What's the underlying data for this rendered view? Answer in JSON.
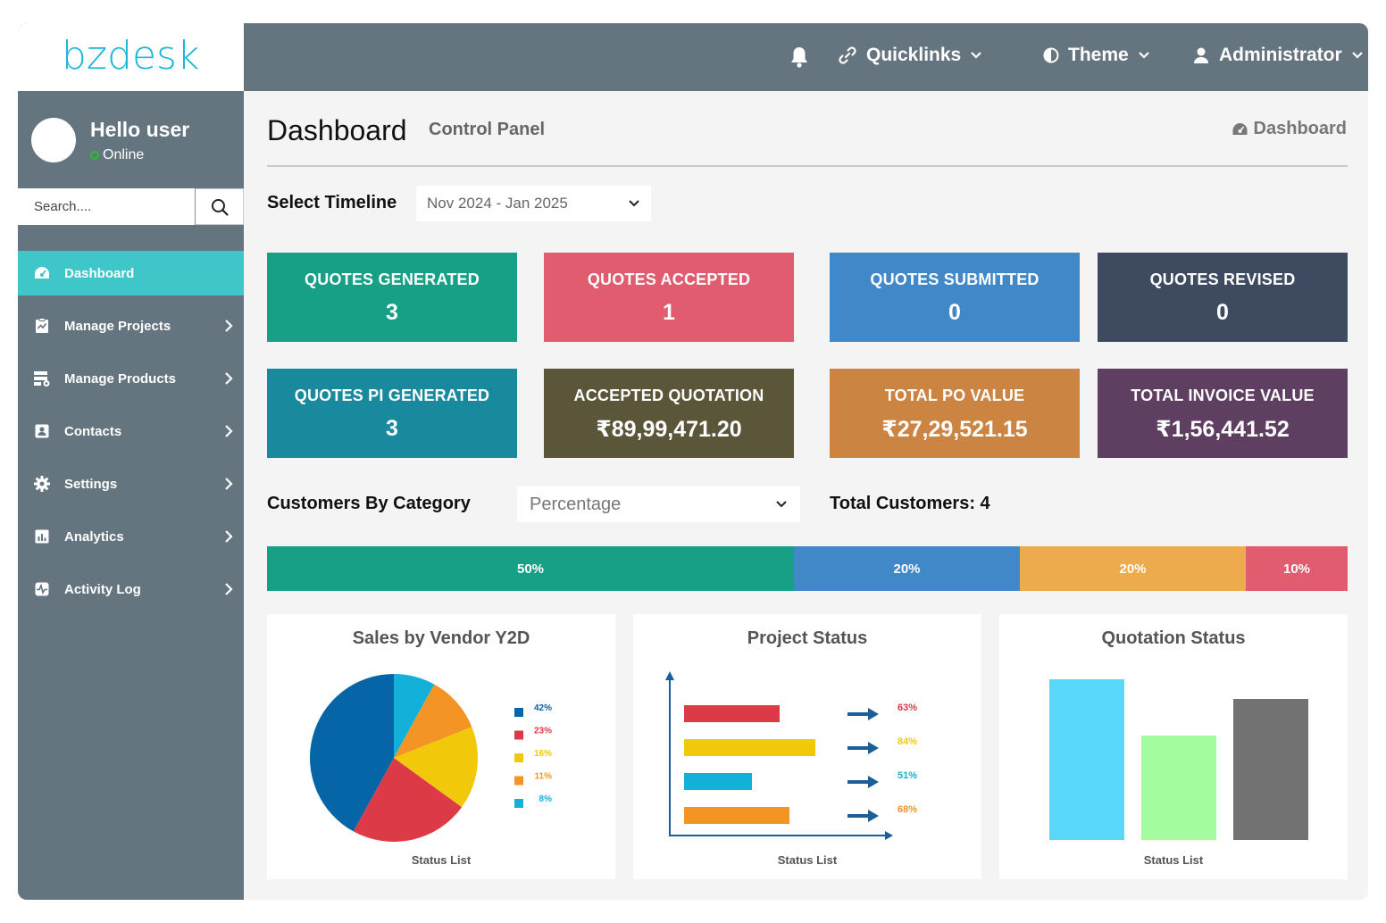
{
  "app": {
    "logo_text": "bzdesk"
  },
  "user": {
    "greeting": "Hello user",
    "status": "Online"
  },
  "search": {
    "placeholder": "Search...."
  },
  "sidebar": {
    "items": [
      {
        "label": "Dashboard",
        "icon": "dashboard-icon",
        "active": true
      },
      {
        "label": "Manage Projects",
        "icon": "projects-icon"
      },
      {
        "label": "Manage Products",
        "icon": "products-icon"
      },
      {
        "label": "Contacts",
        "icon": "contacts-icon"
      },
      {
        "label": "Settings",
        "icon": "gear-icon"
      },
      {
        "label": "Analytics",
        "icon": "analytics-icon"
      },
      {
        "label": "Activity Log",
        "icon": "activity-icon"
      }
    ]
  },
  "topbar": {
    "quicklinks": "Quicklinks",
    "theme": "Theme",
    "user": "Administrator"
  },
  "header": {
    "title": "Dashboard",
    "subtitle": "Control Panel",
    "breadcrumb": "Dashboard"
  },
  "timeline": {
    "label": "Select Timeline",
    "value": "Nov 2024 - Jan 2025"
  },
  "cards": [
    {
      "label": "QUOTES GENERATED",
      "value": "3",
      "color": "#17a085"
    },
    {
      "label": "QUOTES ACCEPTED",
      "value": "1",
      "color": "#e05c6e"
    },
    {
      "label": "QUOTES SUBMITTED",
      "value": "0",
      "color": "#4188c8"
    },
    {
      "label": "QUOTES REVISED",
      "value": "0",
      "color": "#3d4a5f"
    },
    {
      "label": "QUOTES PI GENERATED",
      "value": "3",
      "color": "#198a9e"
    },
    {
      "label": "ACCEPTED QUOTATION",
      "value": "₹89,99,471.20",
      "color": "#5b563a"
    },
    {
      "label": "TOTAL PO VALUE",
      "value": "₹27,29,521.15",
      "color": "#cc8443"
    },
    {
      "label": "TOTAL INVOICE VALUE",
      "value": "₹1,56,441.52",
      "color": "#5e3f62"
    }
  ],
  "customers": {
    "label": "Customers By Category",
    "mode": "Percentage",
    "total": "Total Customers: 4",
    "segments": [
      {
        "label": "50%",
        "value": 50,
        "color": "#17a085"
      },
      {
        "label": "20%",
        "value": 20,
        "color": "#4188c8"
      },
      {
        "label": "20%",
        "value": 20,
        "color": "#eeab4d"
      },
      {
        "label": "10%",
        "value": 10,
        "color": "#e05c6e"
      }
    ]
  },
  "chart_data": [
    {
      "type": "pie",
      "title": "Sales by Vendor Y2D",
      "xlabel": "Status List",
      "slices": [
        {
          "label": "42%",
          "value": 42,
          "color": "#0565a6"
        },
        {
          "label": "23%",
          "value": 23,
          "color": "#dc3a47"
        },
        {
          "label": "16%",
          "value": 16,
          "color": "#f2c90a"
        },
        {
          "label": "11%",
          "value": 11,
          "color": "#f39424"
        },
        {
          "label": "8%",
          "value": 8,
          "color": "#13b0da"
        }
      ]
    },
    {
      "type": "bar",
      "orientation": "horizontal",
      "title": "Project Status",
      "xlabel": "Status List",
      "values": [
        63,
        84,
        51,
        68
      ],
      "labels": [
        "63%",
        "84%",
        "51%",
        "68%"
      ],
      "colors": [
        "#dc3a47",
        "#f2c90a",
        "#13b0da",
        "#f39424"
      ]
    },
    {
      "type": "bar",
      "title": "Quotation Status",
      "xlabel": "Status List",
      "values": [
        100,
        65,
        88
      ],
      "colors": [
        "#5ad8fb",
        "#a3fc9f",
        "#727272"
      ]
    }
  ]
}
